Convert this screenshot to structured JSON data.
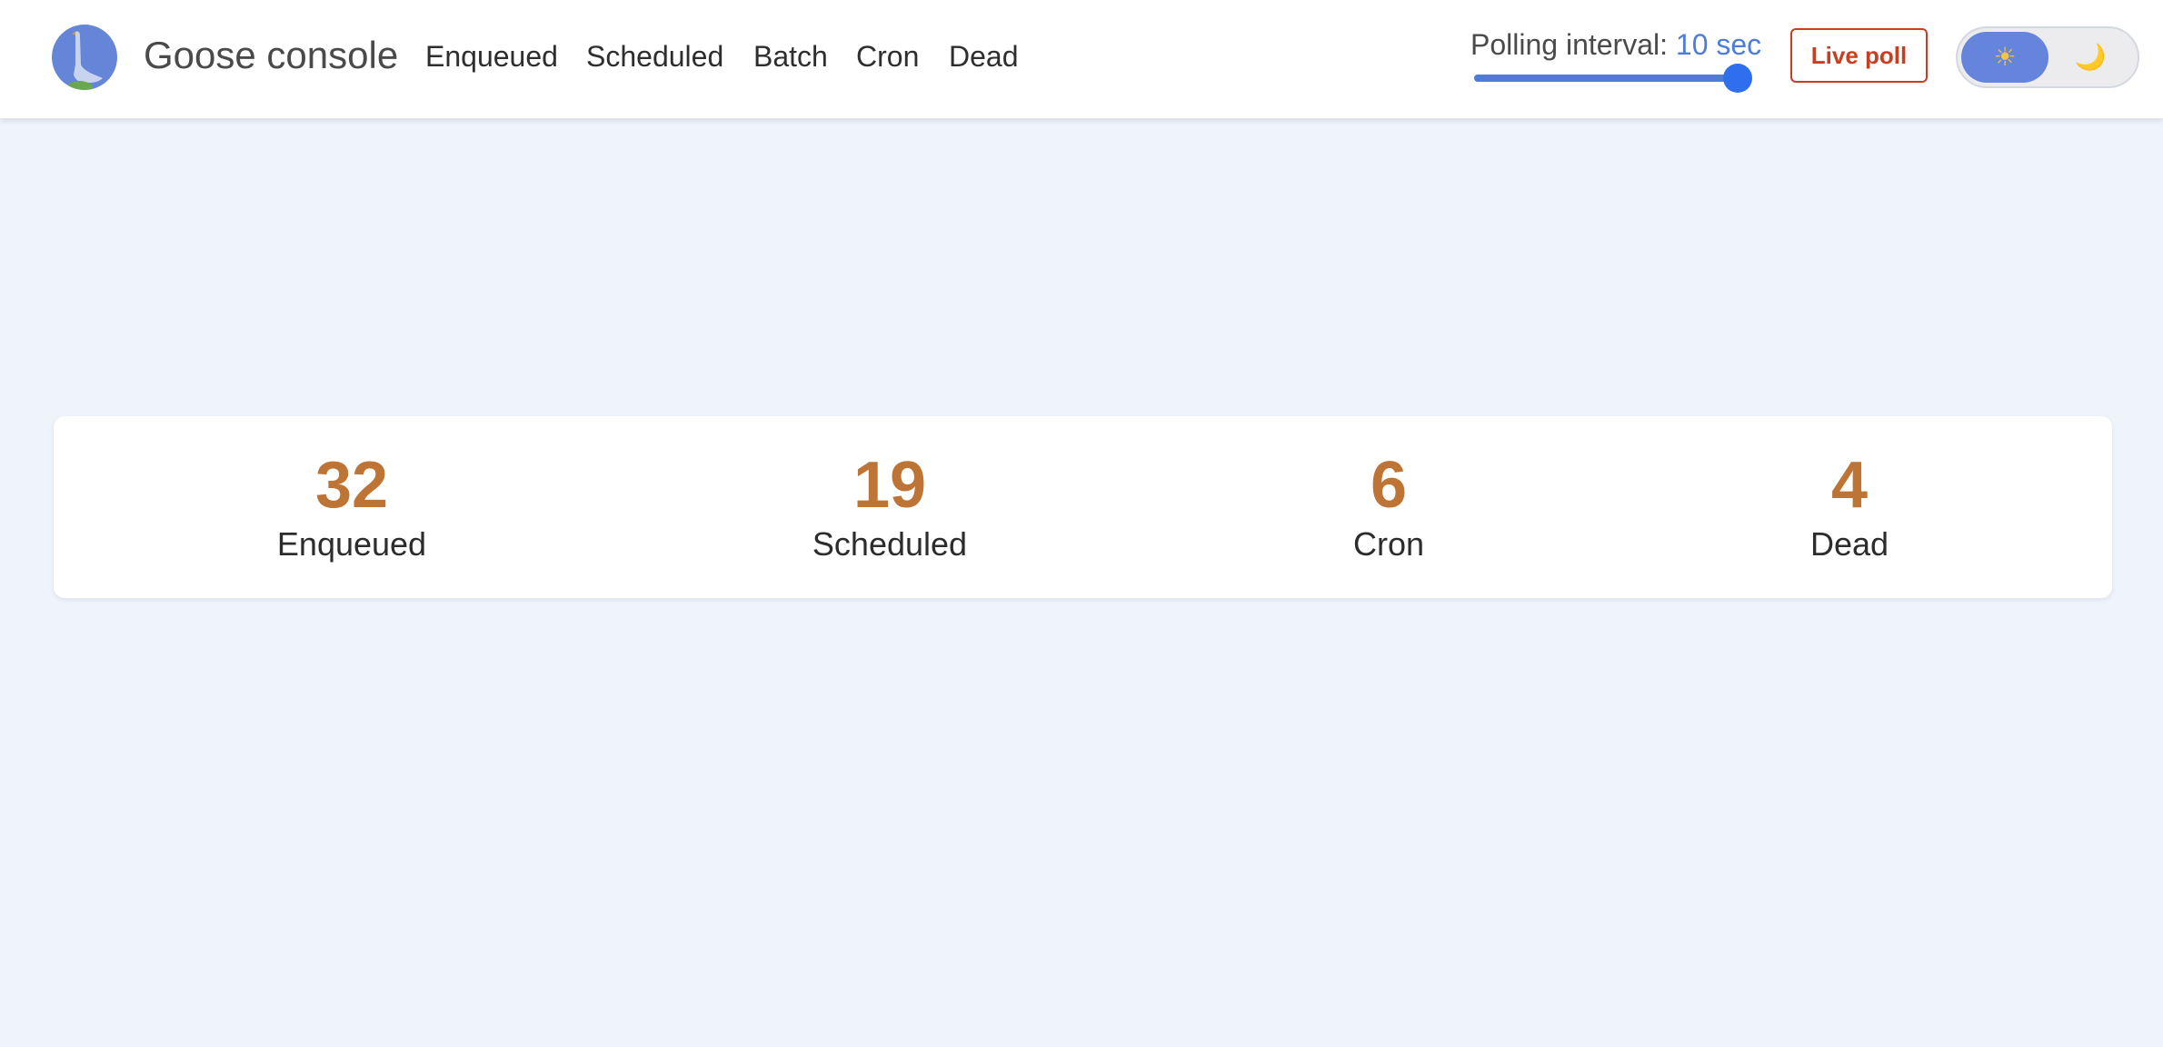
{
  "navbar": {
    "brand": "Goose console",
    "links": [
      "Enqueued",
      "Scheduled",
      "Batch",
      "Cron",
      "Dead"
    ],
    "polling": {
      "label": "Polling interval:",
      "value": "10 sec",
      "slider_fraction": 1.0
    },
    "live_poll_label": "Live poll",
    "theme": {
      "selected": "light",
      "light_icon": "☀",
      "dark_icon": "🌙"
    }
  },
  "stats": [
    {
      "value": "32",
      "label": "Enqueued"
    },
    {
      "value": "19",
      "label": "Scheduled"
    },
    {
      "value": "6",
      "label": "Cron"
    },
    {
      "value": "4",
      "label": "Dead"
    }
  ],
  "colors": {
    "accent": "#4f7bd9",
    "slider_thumb": "#2f6fef",
    "live_poll": "#cc3d1f",
    "stat_value": "#bd7434",
    "page_background": "#eff3fb"
  }
}
